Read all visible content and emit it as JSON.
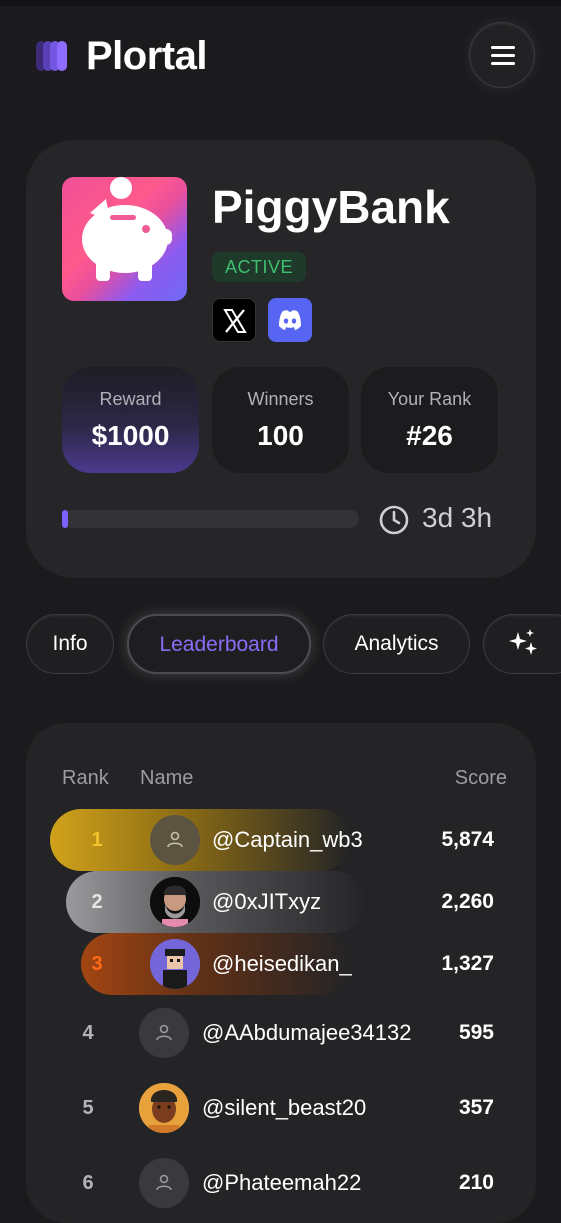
{
  "app": {
    "title": "Plortal",
    "menu_icon": "hamburger-menu-icon"
  },
  "colors": {
    "accent": "#7b61ff",
    "active_green": "#3fbf6f",
    "gold": "#f2c12e",
    "bronze": "#ff6a1a"
  },
  "quest": {
    "name": "PiggyBank",
    "status": "ACTIVE",
    "socials": [
      "x-logo-icon",
      "discord-icon"
    ],
    "stats": [
      {
        "label": "Reward",
        "value": "$1000"
      },
      {
        "label": "Winners",
        "value": "100"
      },
      {
        "label": "Your Rank",
        "value": "#26"
      }
    ],
    "progress": 0.02,
    "time_left": "3d 3h"
  },
  "tabs": [
    {
      "label": "Info"
    },
    {
      "label": "Leaderboard",
      "active": true
    },
    {
      "label": "Analytics"
    },
    {
      "label": "",
      "icon": "sparkles-icon"
    }
  ],
  "leaderboard": {
    "headers": {
      "rank": "Rank",
      "name": "Name",
      "score": "Score"
    },
    "rows": [
      {
        "rank": "1",
        "name": "@Captain_wb3",
        "score": "5,874"
      },
      {
        "rank": "2",
        "name": "@0xJITxyz",
        "score": "2,260"
      },
      {
        "rank": "3",
        "name": "@heisedikan_",
        "score": "1,327"
      },
      {
        "rank": "4",
        "name": "@AAbdumajee34132",
        "score": "595"
      },
      {
        "rank": "5",
        "name": "@silent_beast20",
        "score": "357"
      },
      {
        "rank": "6",
        "name": "@Phateemah22",
        "score": "210"
      }
    ]
  }
}
